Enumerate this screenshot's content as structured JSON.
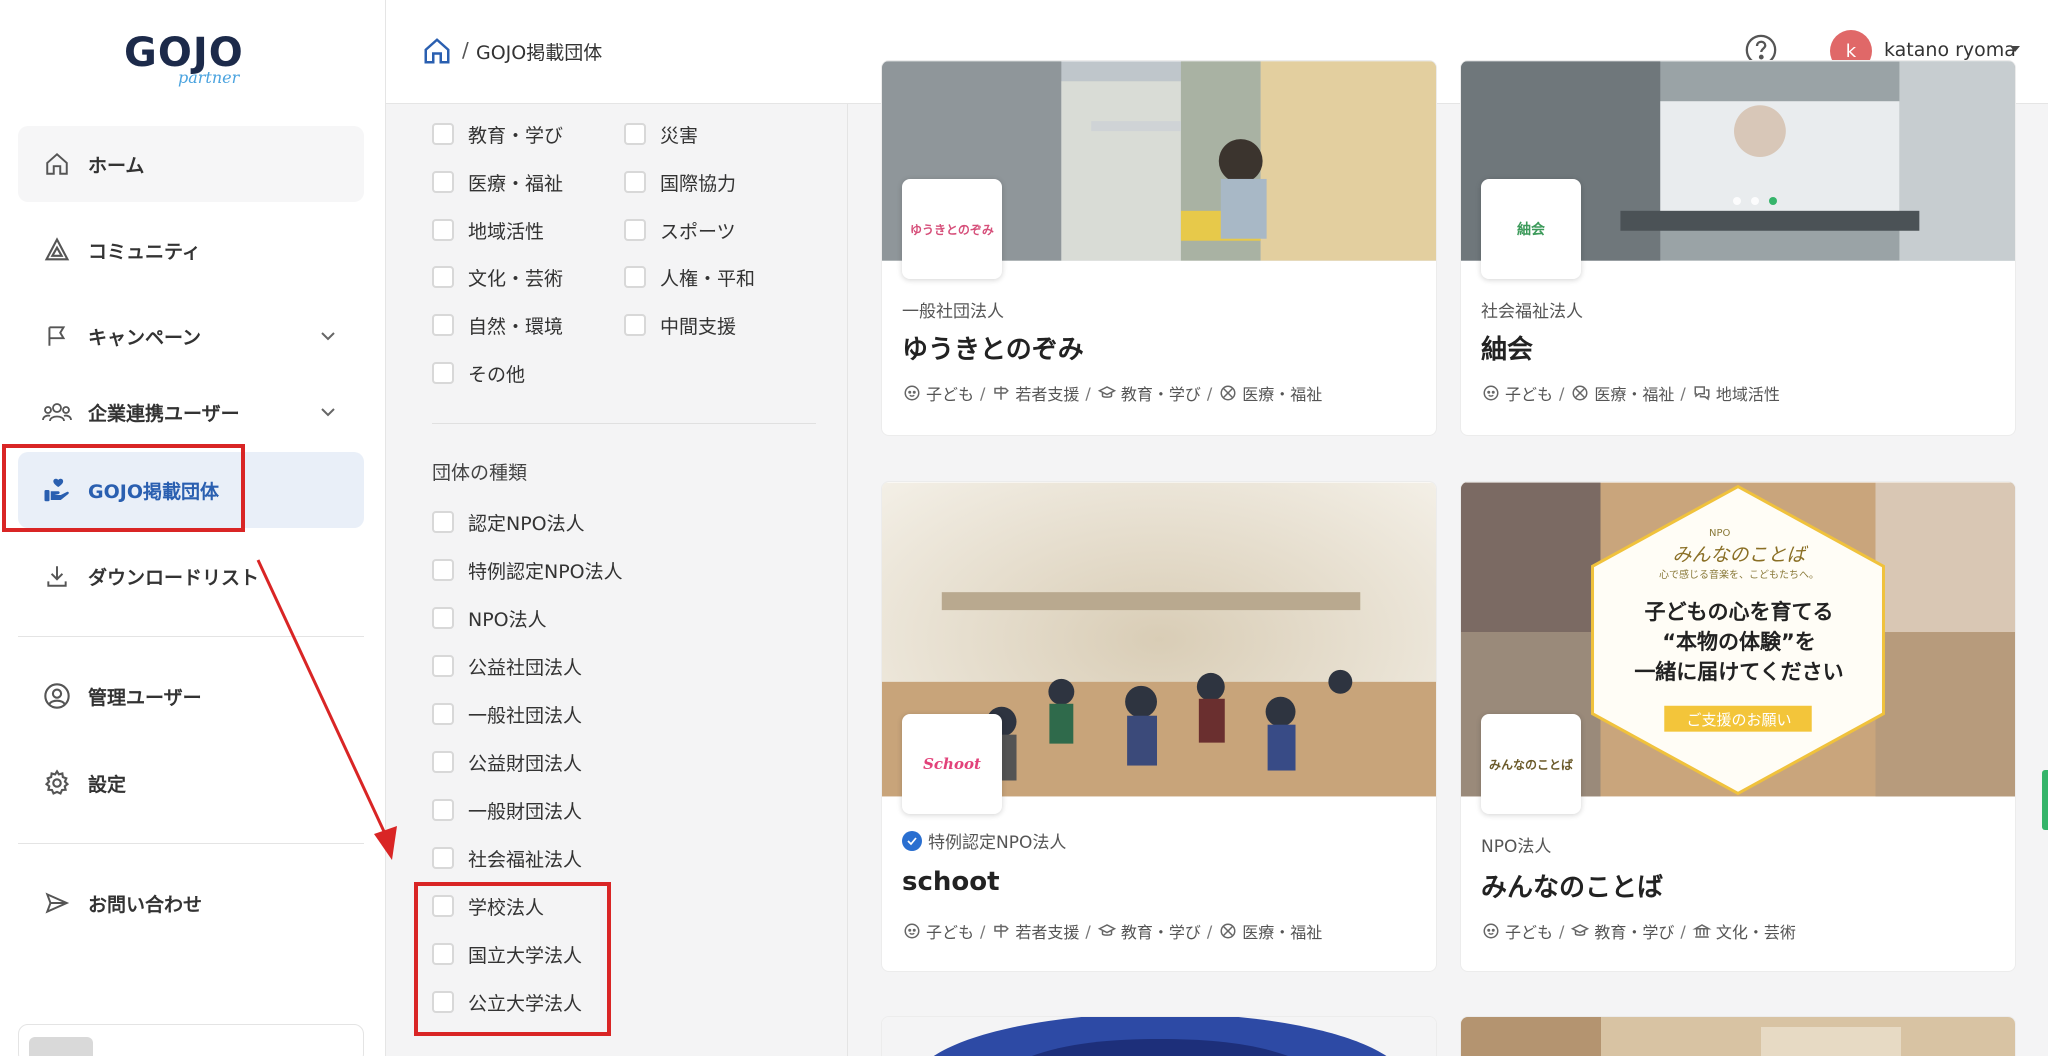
{
  "logo": {
    "main": "GOJO",
    "sub": "partner"
  },
  "sidebar": {
    "items": [
      {
        "label": "ホーム"
      },
      {
        "label": "コミュニティ"
      },
      {
        "label": "キャンペーン"
      },
      {
        "label": "企業連携ユーザー"
      },
      {
        "label": "GOJO掲載団体"
      },
      {
        "label": "ダウンロードリスト"
      },
      {
        "label": "管理ユーザー"
      },
      {
        "label": "設定"
      },
      {
        "label": "お問い合わせ"
      }
    ]
  },
  "header": {
    "breadcrumb": "GOJO掲載団体",
    "separator": "/",
    "avatar_initial": "k",
    "user_name": "katano ryoma"
  },
  "filters": {
    "categories": [
      "教育・学び",
      "災害",
      "医療・福祉",
      "国際協力",
      "地域活性",
      "スポーツ",
      "文化・芸術",
      "人権・平和",
      "自然・環境",
      "中間支援",
      "その他"
    ],
    "org_type_title": "団体の種類",
    "org_types": [
      "認定NPO法人",
      "特例認定NPO法人",
      "NPO法人",
      "公益社団法人",
      "一般社団法人",
      "公益財団法人",
      "一般財団法人",
      "社会福祉法人",
      "学校法人",
      "国立大学法人",
      "公立大学法人"
    ]
  },
  "cards": [
    {
      "logo_text": "ゆうきとのぞみ",
      "type": "一般社団法人",
      "name": "ゆうきとのぞみ",
      "tags": [
        "子ども",
        "若者支援",
        "教育・学び",
        "医療・福祉"
      ]
    },
    {
      "logo_text": "紬会",
      "type": "社会福祉法人",
      "name": "紬会",
      "tags": [
        "子ども",
        "医療・福祉",
        "地域活性"
      ]
    },
    {
      "logo_text": "Schoot",
      "type": "特例認定NPO法人",
      "name": "schoot",
      "tags": [
        "子ども",
        "若者支援",
        "教育・学び",
        "医療・福祉"
      ]
    },
    {
      "logo_text": "みんなのことば",
      "type": "NPO法人",
      "name": "みんなのことば",
      "tags": [
        "子ども",
        "教育・学び",
        "文化・芸術"
      ],
      "banner": {
        "badge": "NPO",
        "title": "みんなのことば",
        "subtitle": "心で感じる音楽を、こどもたちへ。",
        "headline1": "子どもの心を育てる",
        "headline2": "“本物の体験”を",
        "headline3": "一緒に届けてください",
        "cta": "ご支援のお願い"
      }
    }
  ],
  "colors": {
    "accent": "#2a5fb0",
    "active_bg": "#e9eff8",
    "annotation": "#d92525",
    "avatar": "#e06868"
  }
}
